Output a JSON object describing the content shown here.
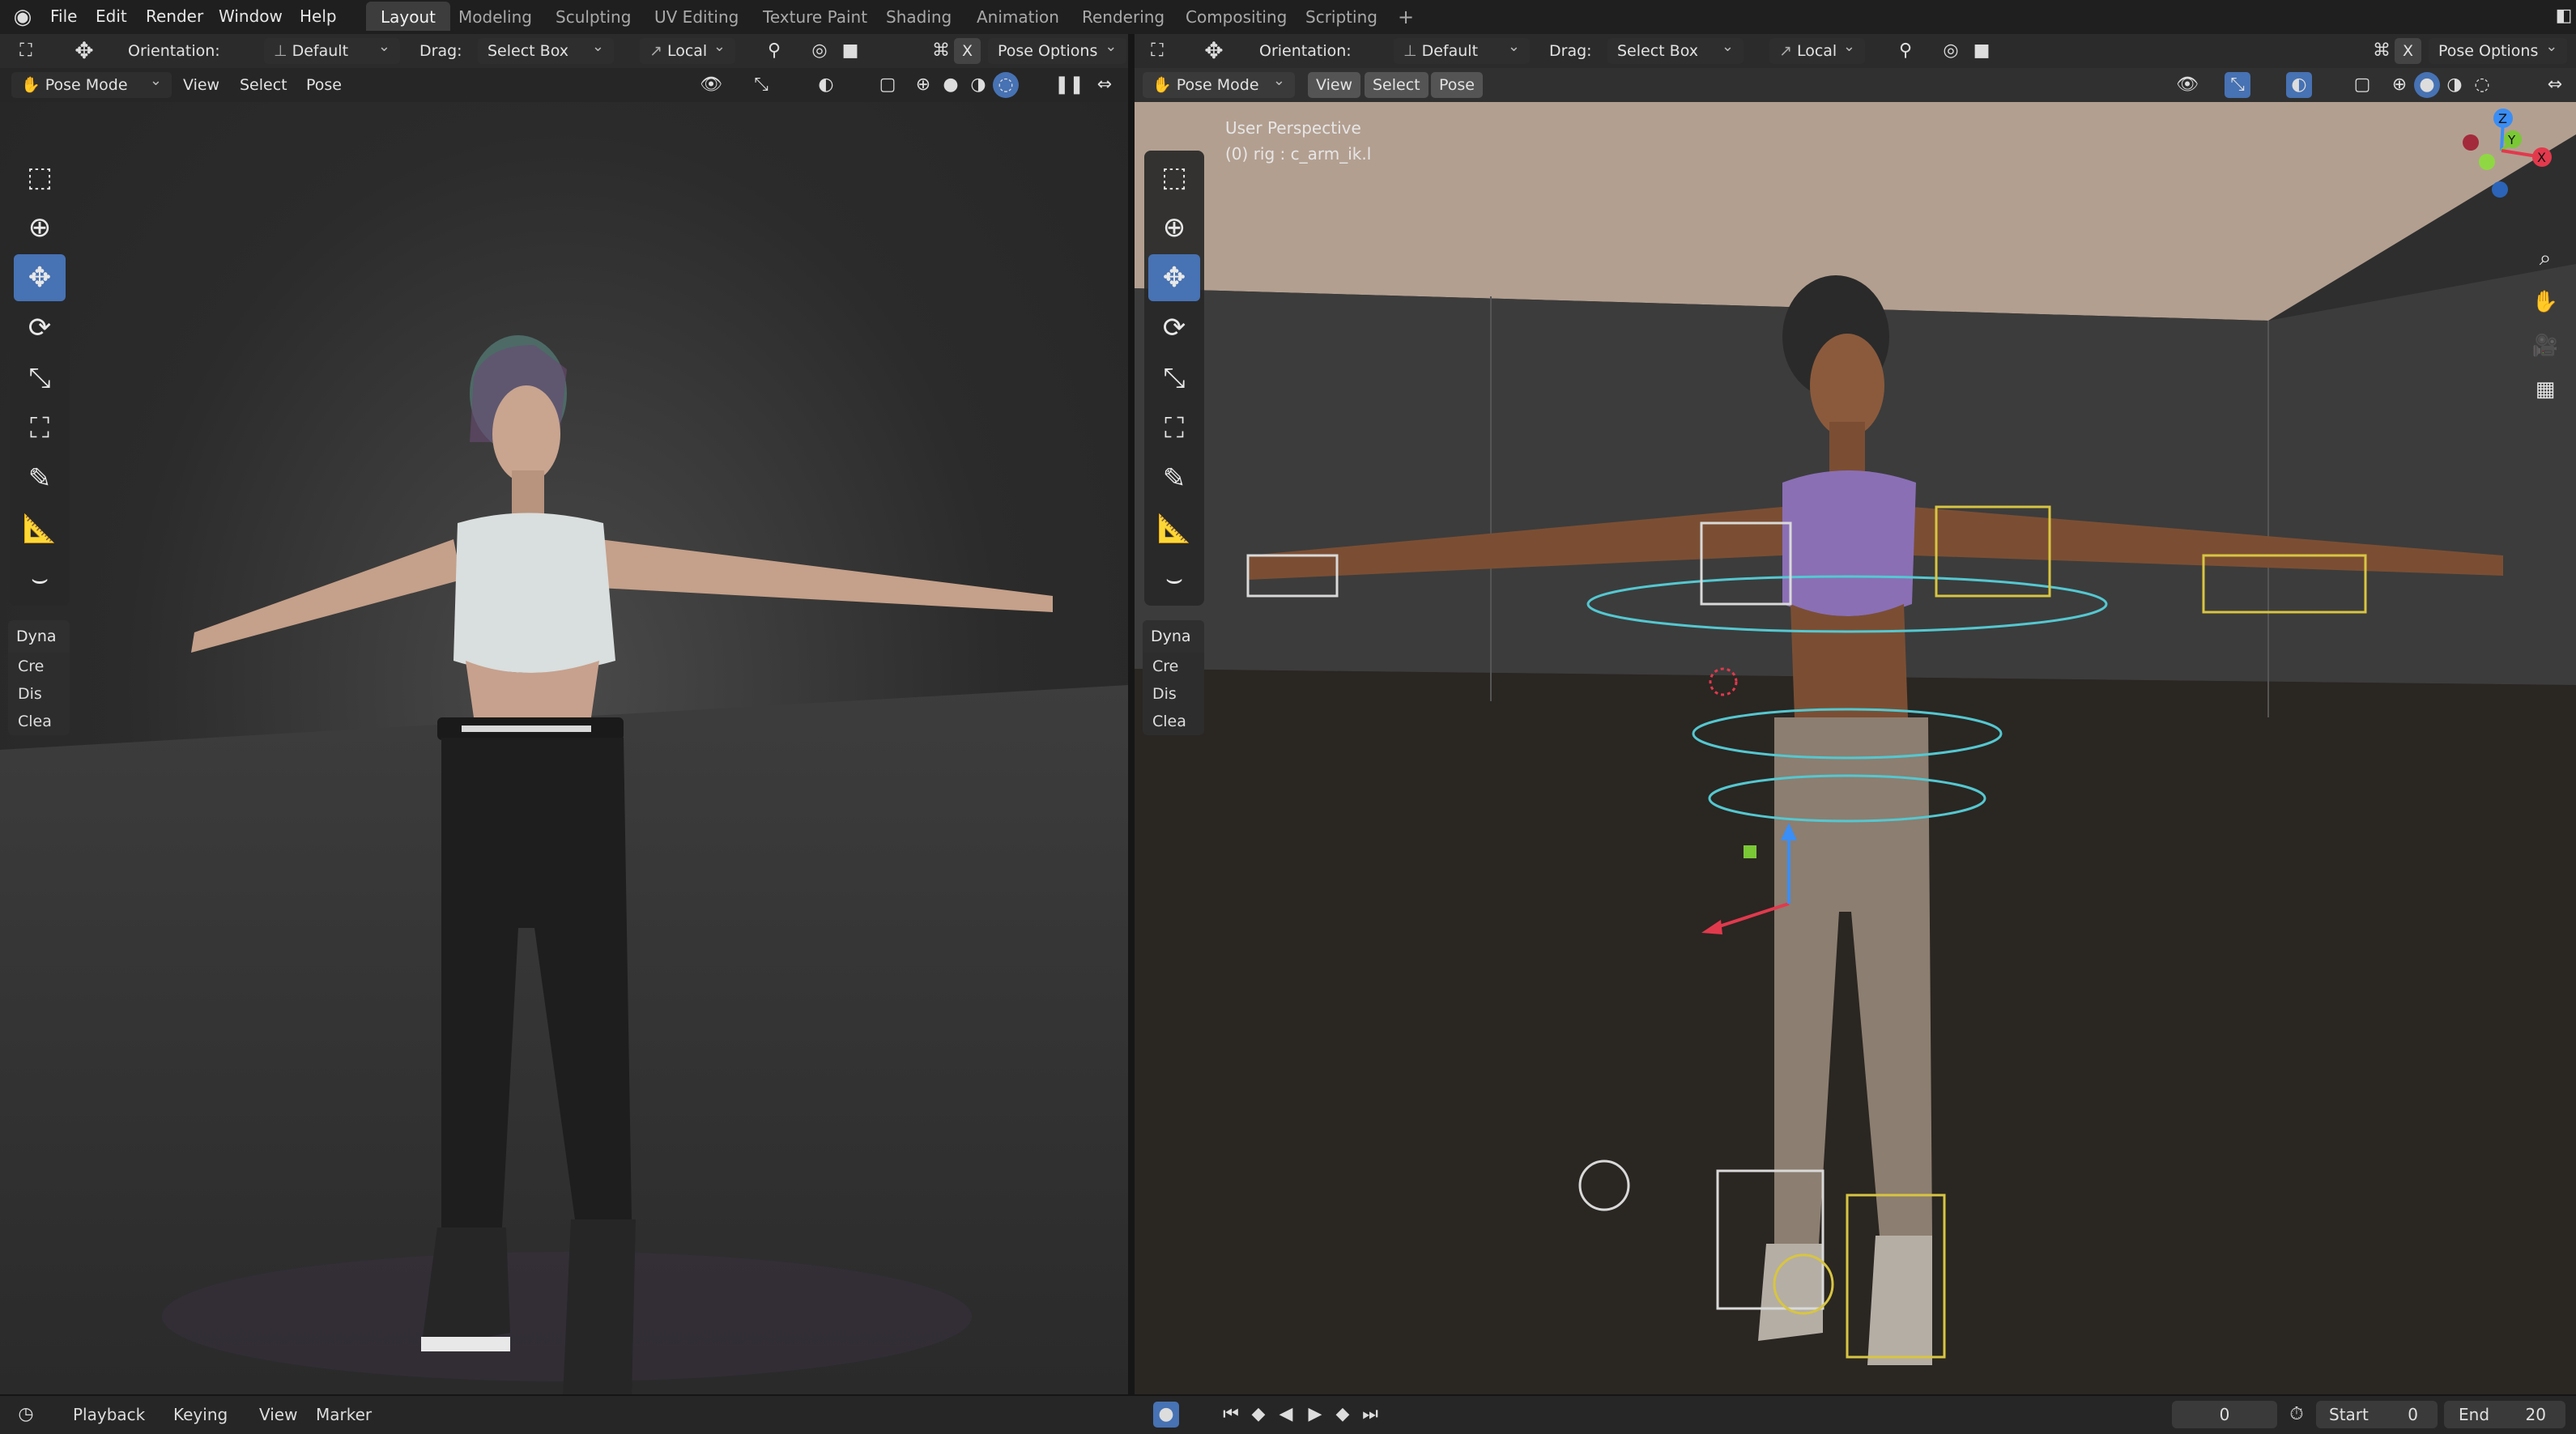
{
  "menu": {
    "items": [
      "File",
      "Edit",
      "Render",
      "Window",
      "Help"
    ]
  },
  "workspaces": [
    "Layout",
    "Modeling",
    "Sculpting",
    "UV Editing",
    "Texture Paint",
    "Shading",
    "Animation",
    "Rendering",
    "Compositing",
    "Scripting"
  ],
  "workspace_add": "+",
  "left": {
    "orientation_label": "Orientation:",
    "orientation_value": "Default",
    "drag_label": "Drag:",
    "drag_value": "Select Box",
    "pivot_value": "Local",
    "pose_options": "Pose Options",
    "mode": "Pose Mode",
    "menus": [
      "View",
      "Select",
      "Pose"
    ],
    "x_mark": "X"
  },
  "right": {
    "orientation_label": "Orientation:",
    "orientation_value": "Default",
    "drag_label": "Drag:",
    "drag_value": "Select Box",
    "pivot_value": "Local",
    "pose_options": "Pose Options",
    "mode": "Pose Mode",
    "menus": [
      "View",
      "Select",
      "Pose"
    ],
    "x_mark": "X",
    "viewport_title": "User Perspective",
    "viewport_subtitle": "(0) rig : c_arm_ik.l"
  },
  "dyna_panel": {
    "title": "Dyna",
    "items": [
      "Cre",
      "Dis",
      "Clea"
    ]
  },
  "timeline": {
    "menus": [
      "Playback",
      "Keying",
      "View",
      "Marker"
    ],
    "current_frame": "0",
    "start_label": "Start",
    "start_value": "0",
    "end_label": "End",
    "end_value": "20"
  },
  "gizmo": {
    "axes": [
      "Z",
      "Y",
      "X"
    ]
  },
  "colors": {
    "accent": "#4772b3",
    "x_axis": "#e2394d",
    "y_axis": "#7ac836",
    "z_axis": "#3a8ef5"
  }
}
